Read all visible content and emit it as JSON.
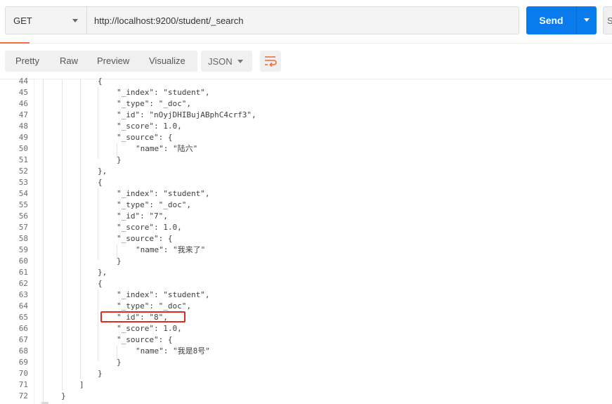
{
  "request": {
    "method": "GET",
    "url": "http://localhost:9200/student/_search",
    "send_label": "Send",
    "save_edge_label": "S"
  },
  "response_toolbar": {
    "tabs": [
      "Pretty",
      "Raw",
      "Preview",
      "Visualize"
    ],
    "format": "JSON"
  },
  "colors": {
    "accent": "#f26b3a",
    "send_button": "#097bed",
    "highlight_box": "#e02a1c"
  },
  "code": {
    "lines": [
      {
        "n": "44",
        "text": "{"
      },
      {
        "n": "45",
        "text": "    \"_index\": \"student\","
      },
      {
        "n": "46",
        "text": "    \"_type\": \"_doc\","
      },
      {
        "n": "47",
        "text": "    \"_id\": \"nOyjDHIBujABphC4crf3\","
      },
      {
        "n": "48",
        "text": "    \"_score\": 1.0,"
      },
      {
        "n": "49",
        "text": "    \"_source\": {"
      },
      {
        "n": "50",
        "text": "        \"name\": \"陆六\""
      },
      {
        "n": "51",
        "text": "    }"
      },
      {
        "n": "52",
        "text": "},"
      },
      {
        "n": "53",
        "text": "{"
      },
      {
        "n": "54",
        "text": "    \"_index\": \"student\","
      },
      {
        "n": "55",
        "text": "    \"_type\": \"_doc\","
      },
      {
        "n": "56",
        "text": "    \"_id\": \"7\","
      },
      {
        "n": "57",
        "text": "    \"_score\": 1.0,"
      },
      {
        "n": "58",
        "text": "    \"_source\": {"
      },
      {
        "n": "59",
        "text": "        \"name\": \"我来了\""
      },
      {
        "n": "60",
        "text": "    }"
      },
      {
        "n": "61",
        "text": "},"
      },
      {
        "n": "62",
        "text": "{"
      },
      {
        "n": "63",
        "text": "    \"_index\": \"student\","
      },
      {
        "n": "64",
        "text": "    \"_type\": \"_doc\","
      },
      {
        "n": "65",
        "text": "    \"_id\": \"8\","
      },
      {
        "n": "66",
        "text": "    \"_score\": 1.0,"
      },
      {
        "n": "67",
        "text": "    \"_source\": {"
      },
      {
        "n": "68",
        "text": "        \"name\": \"我是8号\""
      },
      {
        "n": "69",
        "text": "    }"
      },
      {
        "n": "70",
        "text": "}"
      },
      {
        "n": "71",
        "text": "]"
      },
      {
        "n": "72",
        "text": "}"
      }
    ]
  }
}
